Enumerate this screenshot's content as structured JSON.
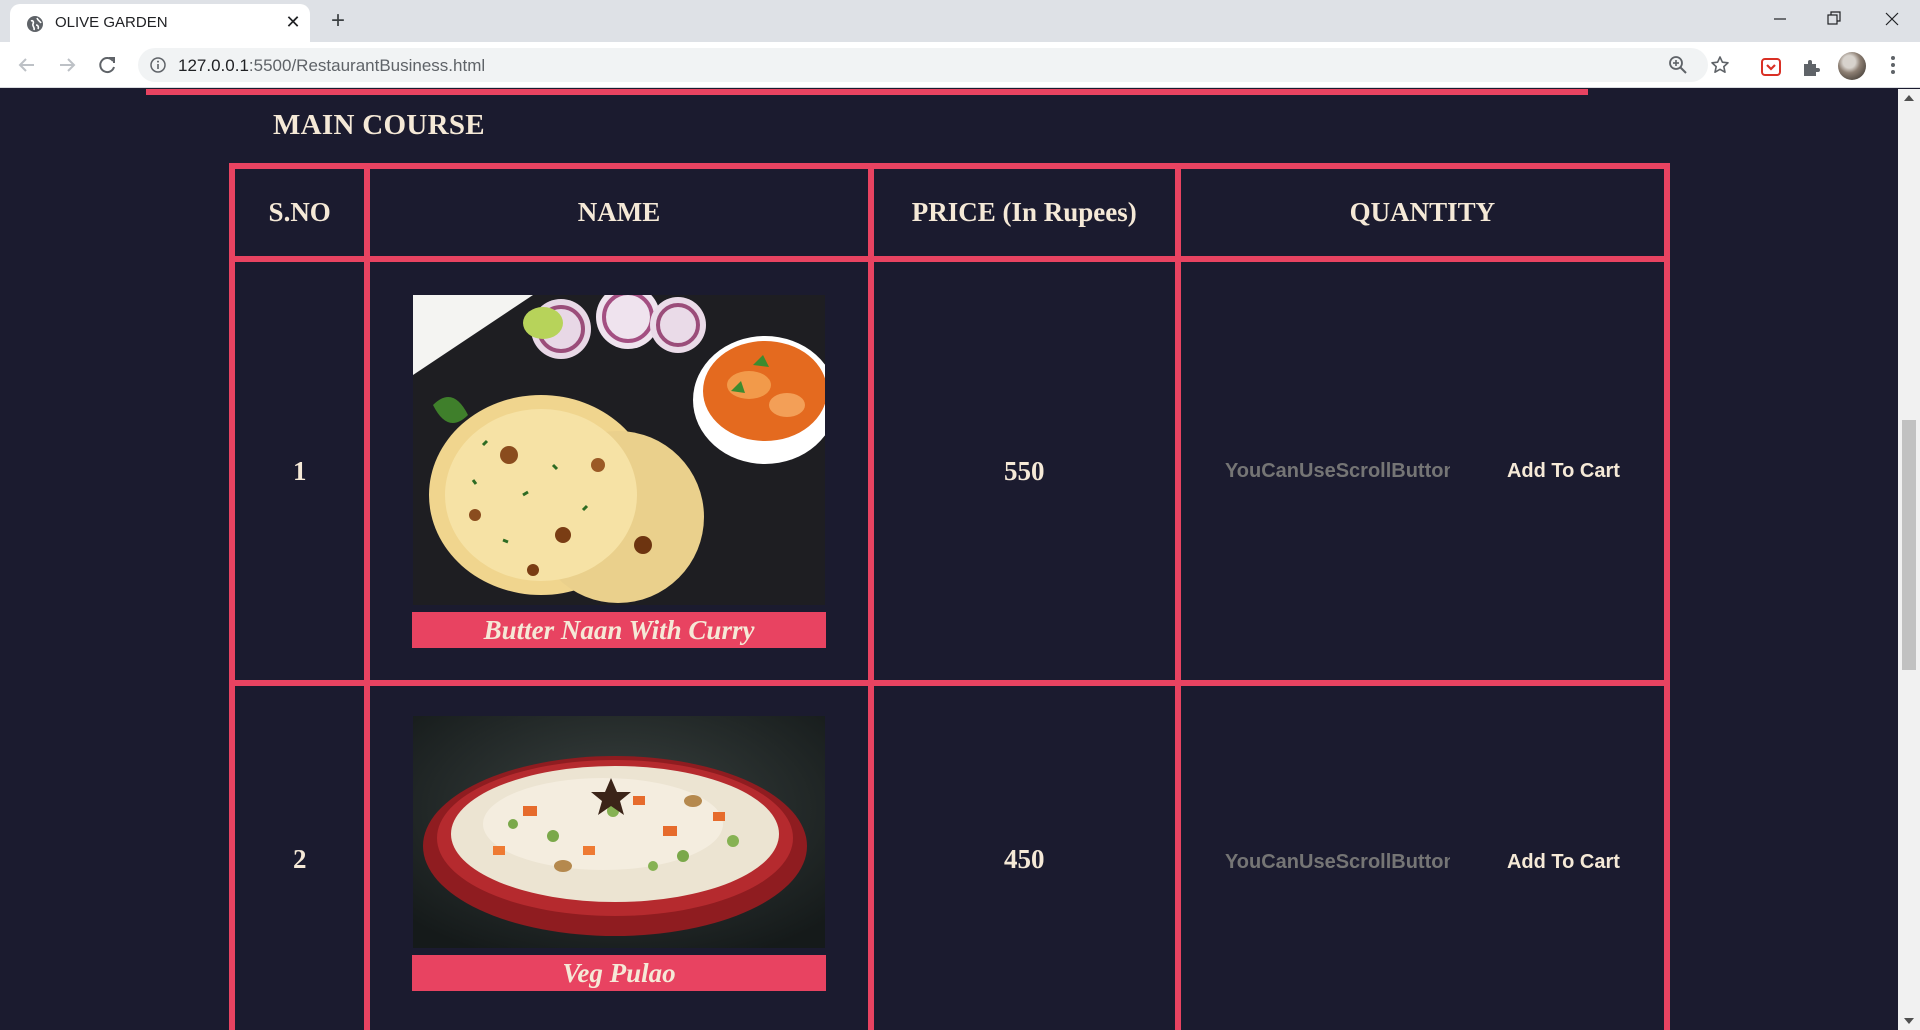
{
  "browser": {
    "tab_title": "OLIVE GARDEN",
    "tab_close": "✕",
    "new_tab": "+",
    "url_host": "127.0.0.1",
    "url_rest": ":5500/RestaurantBusiness.html"
  },
  "page": {
    "section_title": "MAIN COURSE",
    "headers": {
      "sno": "S.NO",
      "name": "NAME",
      "price": "PRICE (In Rupees)",
      "quantity": "QUANTITY"
    },
    "items": [
      {
        "sno": "1",
        "name": "Butter Naan With Curry",
        "price": "550",
        "quantity_placeholder": "YouCanUseScrollButton",
        "button": "Add To Cart"
      },
      {
        "sno": "2",
        "name": "Veg Pulao",
        "price": "450",
        "quantity_placeholder": "YouCanUseScrollButton",
        "button": "Add To Cart"
      }
    ]
  },
  "colors": {
    "background": "#1b1b2f",
    "accent": "#e84361",
    "text": "#f5e9d7"
  }
}
